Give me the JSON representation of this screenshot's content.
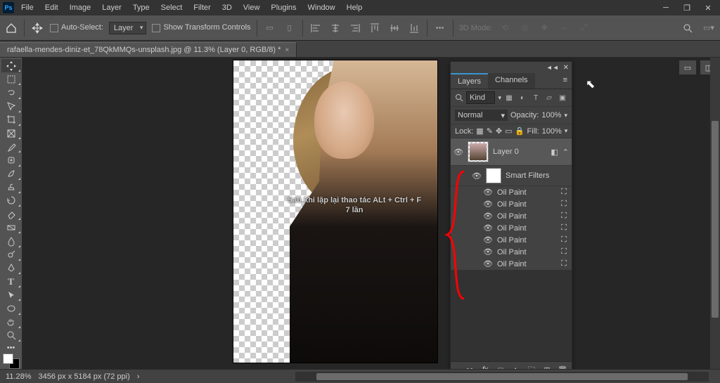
{
  "menu": [
    "File",
    "Edit",
    "Image",
    "Layer",
    "Type",
    "Select",
    "Filter",
    "3D",
    "View",
    "Plugins",
    "Window",
    "Help"
  ],
  "optbar": {
    "auto_select": "Auto-Select:",
    "target": "Layer",
    "show_transform": "Show Transform Controls",
    "mode_3d": "3D Mode:"
  },
  "doc": {
    "tab": "rafaella-mendes-diniz-et_78QkMMQs-unsplash.jpg @ 11.3% (Layer 0, RGB/8) *"
  },
  "annotation": {
    "line1": "Sau khi lặp lại thao tác ALt + Ctrl + F",
    "line2": "7 lần"
  },
  "layers_panel": {
    "tabs": [
      "Layers",
      "Channels"
    ],
    "search_label": "Kind",
    "blend": "Normal",
    "opacity_label": "Opacity:",
    "opacity": "100%",
    "lock_label": "Lock:",
    "fill_label": "Fill:",
    "fill": "100%",
    "layer0": "Layer 0",
    "smart_filters": "Smart Filters",
    "filters": [
      "Oil Paint",
      "Oil Paint",
      "Oil Paint",
      "Oil Paint",
      "Oil Paint",
      "Oil Paint",
      "Oil Paint"
    ]
  },
  "status": {
    "zoom": "11.28%",
    "doc": "3456 px x 5184 px (72 ppi)"
  }
}
